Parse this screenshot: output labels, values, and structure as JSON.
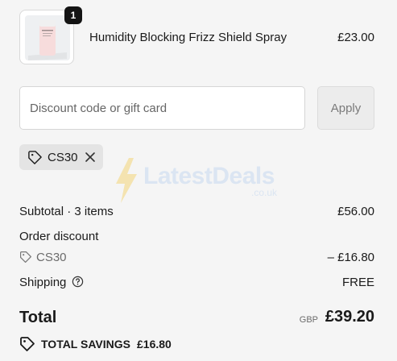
{
  "product": {
    "quantity": "1",
    "name": "Humidity Blocking Frizz Shield Spray",
    "price": "£23.00",
    "image_icon": "spray-bottle-image"
  },
  "discount": {
    "placeholder": "Discount code or gift card",
    "value": "",
    "apply_label": "Apply"
  },
  "applied_code": {
    "label": "CS30",
    "icon": "tag-icon",
    "remove_icon": "close-icon"
  },
  "watermark": {
    "main": "LatestDeals",
    "sub": ".co.uk"
  },
  "summary": {
    "subtotal_label": "Subtotal · 3 items",
    "subtotal_value": "£56.00",
    "order_discount_label": "Order discount",
    "order_discount_code": "CS30",
    "order_discount_value": "– £16.80",
    "shipping_label": "Shipping",
    "shipping_value": "FREE",
    "total_label": "Total",
    "currency": "GBP",
    "total_value": "£39.20",
    "savings_label": "TOTAL SAVINGS",
    "savings_value": "£16.80"
  },
  "colors": {
    "background": "#f5f5f5",
    "badge": "#141414",
    "chip": "#e4e4e4",
    "watermark": "#dbe5f2",
    "watermark_bolt": "#f4e3b0"
  }
}
